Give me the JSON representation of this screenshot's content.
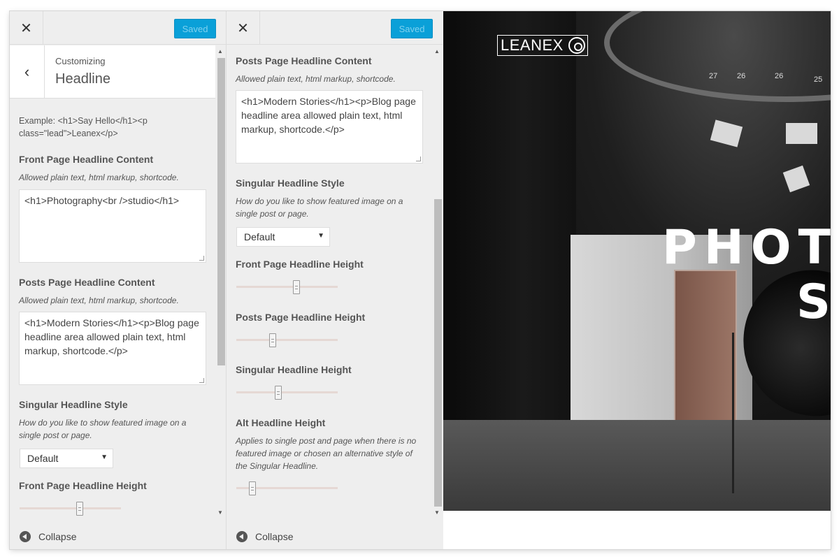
{
  "panelA": {
    "close_icon": "close-icon",
    "saved_label": "Saved",
    "customizing_label": "Customizing",
    "section_title": "Headline",
    "example_text": "Example: <h1>Say Hello</h1><p class=\"lead\">Leanex</p>",
    "front_content": {
      "title": "Front Page Headline Content",
      "desc": "Allowed plain text, html markup, shortcode.",
      "value": "<h1>Photography<br />studio</h1>"
    },
    "posts_content": {
      "title": "Posts Page Headline Content",
      "desc": "Allowed plain text, html markup, shortcode.",
      "value": "<h1>Modern Stories</h1><p>Blog page headline area allowed plain text, html markup, shortcode.</p>"
    },
    "singular_style": {
      "title": "Singular Headline Style",
      "desc": "How do you like to show featured image on a single post or page.",
      "selected": "Default"
    },
    "front_height": {
      "title": "Front Page Headline Height",
      "value": 0.6
    },
    "collapse_label": "Collapse"
  },
  "panelB": {
    "saved_label": "Saved",
    "posts_content": {
      "title": "Posts Page Headline Content",
      "desc": "Allowed plain text, html markup, shortcode.",
      "value": "<h1>Modern Stories</h1><p>Blog page headline area allowed plain text, html markup, shortcode.</p>"
    },
    "singular_style": {
      "title": "Singular Headline Style",
      "desc": "How do you like to show featured image on a single post or page.",
      "selected": "Default"
    },
    "front_height": {
      "title": "Front Page Headline Height",
      "value": 0.6
    },
    "posts_height": {
      "title": "Posts Page Headline Height",
      "value": 0.35
    },
    "singular_height": {
      "title": "Singular Headline Height",
      "value": 0.41
    },
    "alt_height": {
      "title": "Alt Headline Height",
      "desc": "Applies to single post and page when there is no featured image or chosen an alternative style of the Singular Headline.",
      "value": 0.13
    },
    "collapse_label": "Collapse"
  },
  "preview": {
    "logo_text": "LEANEX",
    "hero_line1": "PHOT",
    "hero_line2": "S",
    "ring_numbers": [
      "27",
      "26",
      "26",
      "25"
    ]
  },
  "colors": {
    "saved_bg": "#0aa0d8",
    "panel_bg": "#eeeeee"
  }
}
